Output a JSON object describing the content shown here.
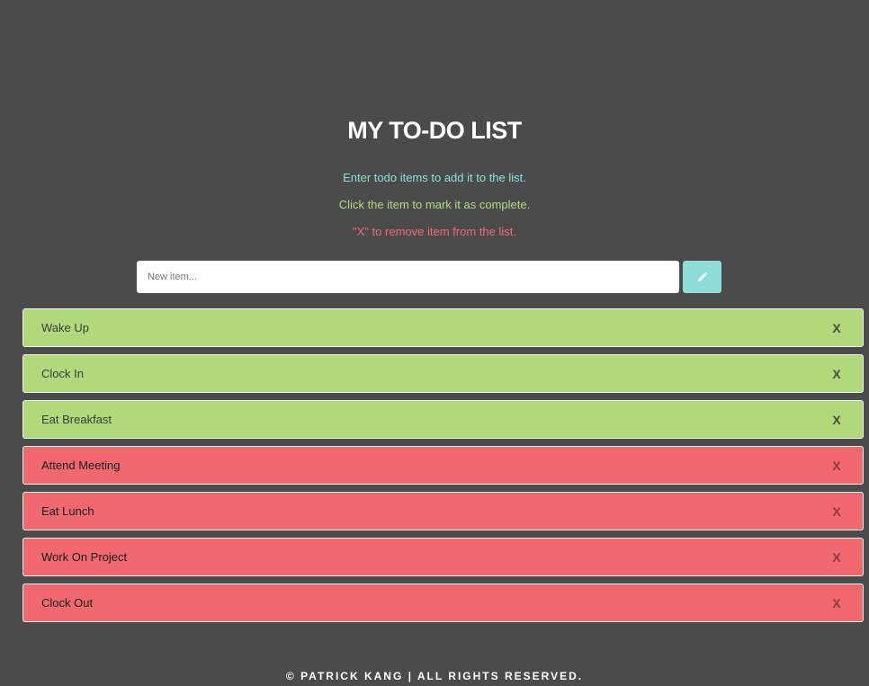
{
  "header": {
    "title": "MY TO-DO LIST",
    "instructions": [
      "Enter todo items to add it to the list.",
      "Click the item to mark it as complete.",
      "\"X\" to remove item from the list."
    ]
  },
  "input": {
    "placeholder": "New item...",
    "value": ""
  },
  "add_button": {
    "icon": "pencil-icon"
  },
  "todos": [
    {
      "text": "Wake Up",
      "status": "complete",
      "remove_label": "X"
    },
    {
      "text": "Clock In",
      "status": "complete",
      "remove_label": "X"
    },
    {
      "text": "Eat Breakfast",
      "status": "complete",
      "remove_label": "X"
    },
    {
      "text": "Attend Meeting",
      "status": "pending",
      "remove_label": "X"
    },
    {
      "text": "Eat Lunch",
      "status": "pending",
      "remove_label": "X"
    },
    {
      "text": "Work On Project",
      "status": "pending",
      "remove_label": "X"
    },
    {
      "text": "Clock Out",
      "status": "pending",
      "remove_label": "X"
    }
  ],
  "footer": {
    "text": "© PATRICK KANG | ALL RIGHTS RESERVED."
  },
  "colors": {
    "background": "#4b4b4b",
    "complete": "#b0d97c",
    "pending": "#f0696f",
    "accent": "#8edcd8"
  }
}
